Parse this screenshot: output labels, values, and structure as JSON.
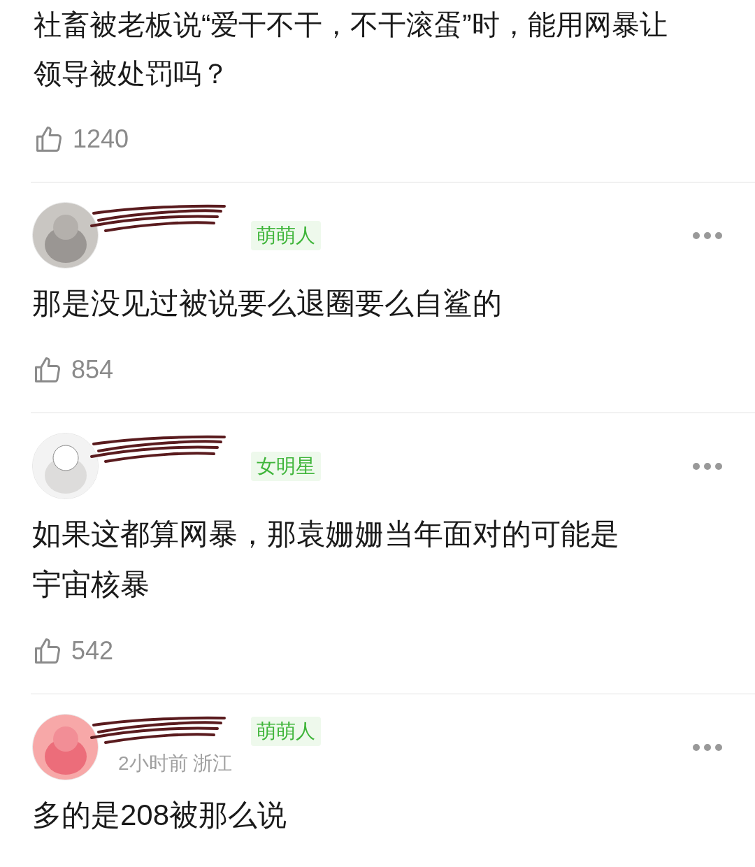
{
  "question": {
    "title": "社畜被老板说“爱干不干，不干滚蛋”时，能用网暴让领导被处罚吗？",
    "likes": "1240"
  },
  "comments": [
    {
      "badge": "萌萌人",
      "text": "那是没见过被说要么退圈要么自鲨的",
      "likes": "854"
    },
    {
      "badge": "女明星",
      "text": "如果这都算网暴，那袁姗姗当年面对的可能是宇宙核暴",
      "likes": "542"
    },
    {
      "badge": "萌萌人",
      "meta": "2小时前 浙江",
      "text": "多的是208被那么说"
    }
  ]
}
